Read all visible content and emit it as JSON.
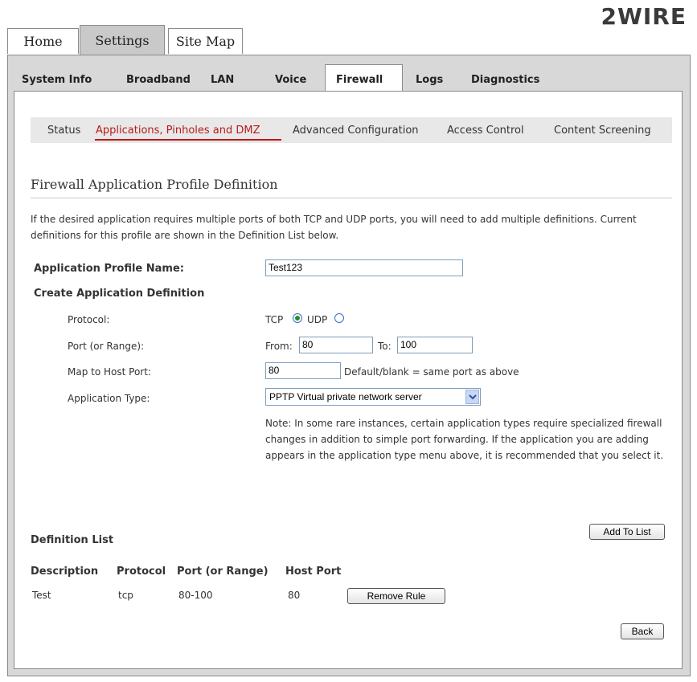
{
  "logo": "2WIRE",
  "top_tabs": [
    "Home",
    "Settings",
    "Site Map"
  ],
  "nav": [
    "System Info",
    "Broadband",
    "LAN",
    "Voice",
    "Firewall",
    "Logs",
    "Diagnostics"
  ],
  "subnav": [
    "Status",
    "Applications, Pinholes and DMZ",
    "Advanced Configuration",
    "Access Control",
    "Content Screening"
  ],
  "section_title": "Firewall Application Profile Definition",
  "intro": "If the desired application requires multiple ports of both TCP and UDP ports, you will need to add multiple definitions. Current definitions for this profile are shown in the Definition List below.",
  "form": {
    "profile_name_label": "Application Profile Name:",
    "profile_name_value": "Test123",
    "create_label": "Create Application Definition",
    "protocol_label": "Protocol:",
    "tcp": "TCP",
    "udp": "UDP",
    "selected_protocol": "TCP",
    "port_label": "Port (or Range):",
    "from_label": "From:",
    "from_value": "80",
    "to_label": "To:",
    "to_value": "100",
    "map_label": "Map to Host Port:",
    "map_value": "80",
    "map_hint": "Default/blank = same port as above",
    "app_type_label": "Application Type:",
    "app_type_value": "PPTP Virtual private network server",
    "note": "Note: In some rare instances, certain application types require specialized firewall changes in addition to simple port forwarding. If the application you are adding appears in the application type menu above, it is recommended that you select it.",
    "add_button": "Add To List"
  },
  "definition_list": {
    "title": "Definition List",
    "headers": [
      "Description",
      "Protocol",
      "Port (or Range)",
      "Host Port"
    ],
    "rows": [
      {
        "description": "Test",
        "protocol": "tcp",
        "port": "80-100",
        "host_port": "80",
        "action": "Remove Rule"
      }
    ]
  },
  "back_button": "Back",
  "colors": {
    "accent_red": "#b81b1b",
    "frame_gray": "#d8d8d8"
  }
}
